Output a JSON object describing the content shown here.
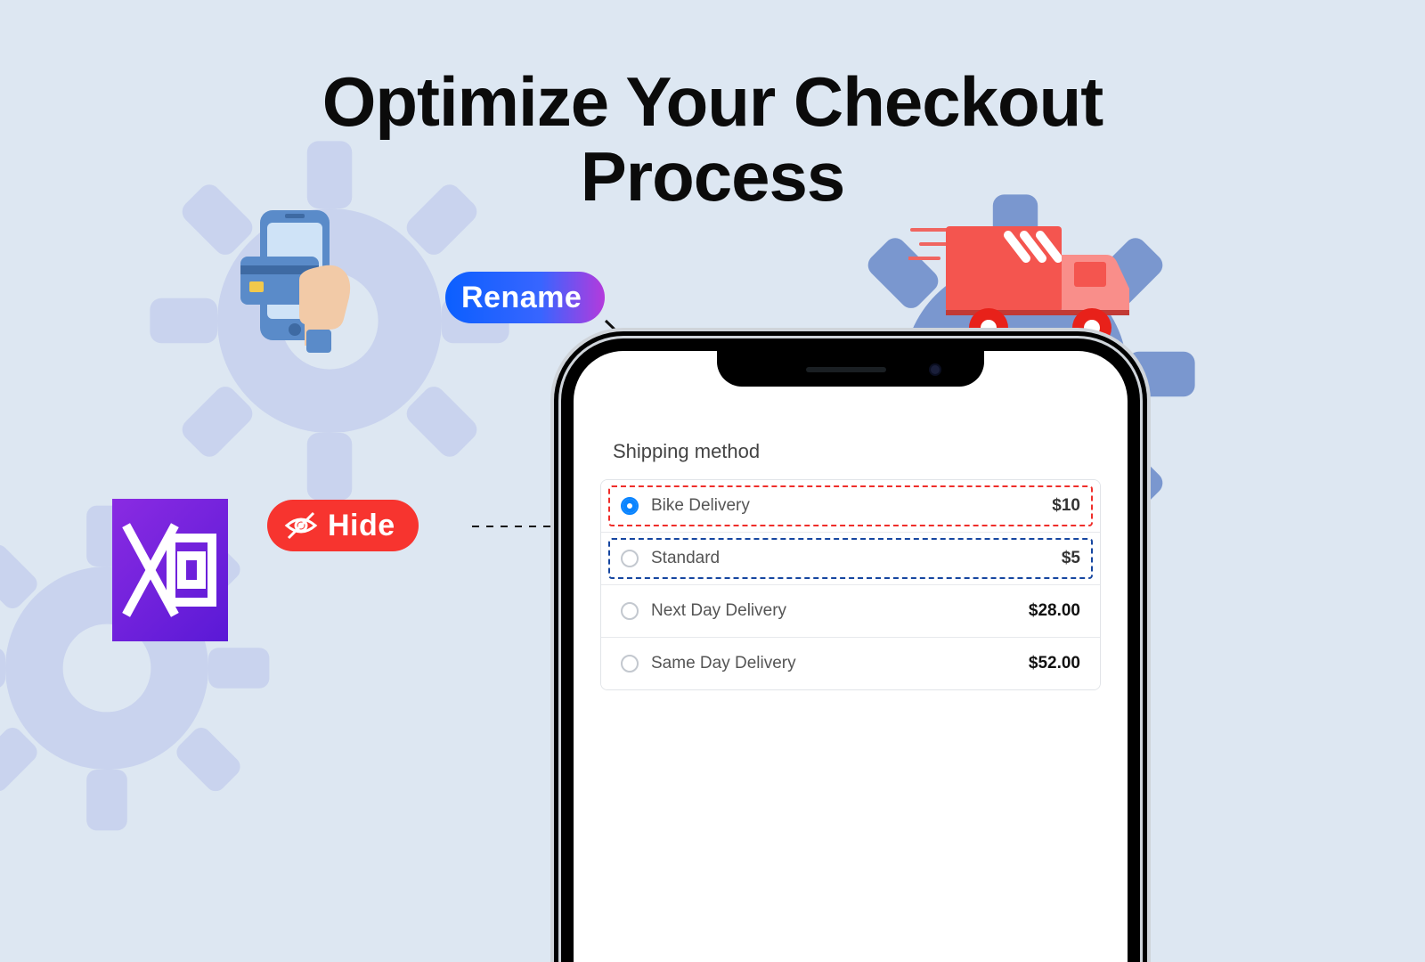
{
  "headline_line1": "Optimize Your Checkout",
  "headline_line2": "Process",
  "pills": {
    "rename": "Rename",
    "hide": "Hide"
  },
  "phone": {
    "section_title": "Shipping method",
    "options": [
      {
        "label": "Bike Delivery",
        "price": "$10",
        "selected": true,
        "highlight": "red"
      },
      {
        "label": "Standard",
        "price": "$5",
        "selected": false,
        "highlight": "blue"
      },
      {
        "label": "Next Day Delivery",
        "price": "$28.00",
        "selected": false,
        "highlight": null
      },
      {
        "label": "Same Day Delivery",
        "price": "$52.00",
        "selected": false,
        "highlight": null
      }
    ]
  }
}
